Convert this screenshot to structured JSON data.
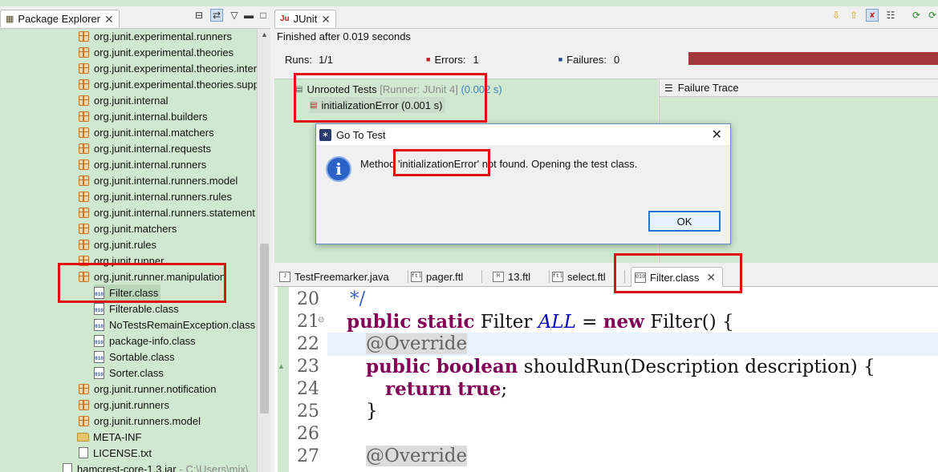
{
  "package_explorer": {
    "title": "Package Explorer",
    "items": [
      {
        "label": "org.junit.experimental.runners",
        "type": "package"
      },
      {
        "label": "org.junit.experimental.theories",
        "type": "package"
      },
      {
        "label": "org.junit.experimental.theories.inter",
        "type": "package"
      },
      {
        "label": "org.junit.experimental.theories.supp",
        "type": "package"
      },
      {
        "label": "org.junit.internal",
        "type": "package"
      },
      {
        "label": "org.junit.internal.builders",
        "type": "package"
      },
      {
        "label": "org.junit.internal.matchers",
        "type": "package"
      },
      {
        "label": "org.junit.internal.requests",
        "type": "package"
      },
      {
        "label": "org.junit.internal.runners",
        "type": "package"
      },
      {
        "label": "org.junit.internal.runners.model",
        "type": "package"
      },
      {
        "label": "org.junit.internal.runners.rules",
        "type": "package"
      },
      {
        "label": "org.junit.internal.runners.statement",
        "type": "package"
      },
      {
        "label": "org.junit.matchers",
        "type": "package"
      },
      {
        "label": "org.junit.rules",
        "type": "package"
      },
      {
        "label": "org.junit.runner",
        "type": "package"
      },
      {
        "label": "org.junit.runner.manipulation",
        "type": "package"
      },
      {
        "label": "Filter.class",
        "type": "class"
      },
      {
        "label": "Filterable.class",
        "type": "class"
      },
      {
        "label": "NoTestsRemainException.class",
        "type": "class"
      },
      {
        "label": "package-info.class",
        "type": "class"
      },
      {
        "label": "Sortable.class",
        "type": "class"
      },
      {
        "label": "Sorter.class",
        "type": "class"
      },
      {
        "label": "org.junit.runner.notification",
        "type": "package"
      },
      {
        "label": "org.junit.runners",
        "type": "package"
      },
      {
        "label": "org.junit.runners.model",
        "type": "package"
      },
      {
        "label": "META-INF",
        "type": "folder"
      },
      {
        "label": "LICENSE.txt",
        "type": "file"
      },
      {
        "label": "hamcrest-core-1.3.jar",
        "type": "jar",
        "suffix": "- C:\\Users\\mix\\."
      }
    ]
  },
  "junit": {
    "title": "JUnit",
    "status": "Finished after 0.019 seconds",
    "runs_label": "Runs:",
    "runs_value": "1/1",
    "errors_label": "Errors:",
    "errors_value": "1",
    "failures_label": "Failures:",
    "failures_value": "0",
    "progress_color": "#a4373a",
    "progress_fraction": 1.0,
    "tree_root": "Unrooted Tests",
    "tree_root_runner": "[Runner: JUnit 4]",
    "tree_root_time": "(0.002 s)",
    "tree_child": "initializationError (0.001 s)",
    "failure_trace_label": "Failure Trace"
  },
  "dialog": {
    "title": "Go To Test",
    "message_prefix": "Method",
    "message_highlight": "'initializationError'",
    "message_suffix": "not found. Opening the test class.",
    "ok_label": "OK"
  },
  "editor": {
    "tabs": [
      {
        "label": "TestFreemarker.java",
        "icon": "J"
      },
      {
        "label": "pager.ftl",
        "icon": "ftl"
      },
      {
        "label": "13.ftl",
        "icon": "H"
      },
      {
        "label": "select.ftl",
        "icon": "ftl"
      },
      {
        "label": "Filter.class",
        "icon": "010"
      }
    ],
    "lines": [
      {
        "num": "20"
      },
      {
        "num": "21"
      },
      {
        "num": "22"
      },
      {
        "num": "23"
      },
      {
        "num": "24"
      },
      {
        "num": "25"
      },
      {
        "num": "26"
      },
      {
        "num": "27"
      }
    ],
    "code": {
      "l20_comment": "*/",
      "l21_kw1": "public",
      "l21_kw2": "static",
      "l21_type": "Filter",
      "l21_field": "ALL",
      "l21_eq": "=",
      "l21_kw3": "new",
      "l21_rest": "Filter() {",
      "l22_ann": "@Override",
      "l23_kw1": "public",
      "l23_kw2": "boolean",
      "l23_rest": "shouldRun(Description description) {",
      "l24_kw": "return",
      "l24_kw2": "true",
      "l24_rest": ";",
      "l25": "}",
      "l27_ann": "@Override"
    }
  },
  "colors": {
    "background": "#cfe8cf",
    "highlight_box": "#e01010",
    "keyword": "#7f0055",
    "progress_error": "#a4373a"
  }
}
